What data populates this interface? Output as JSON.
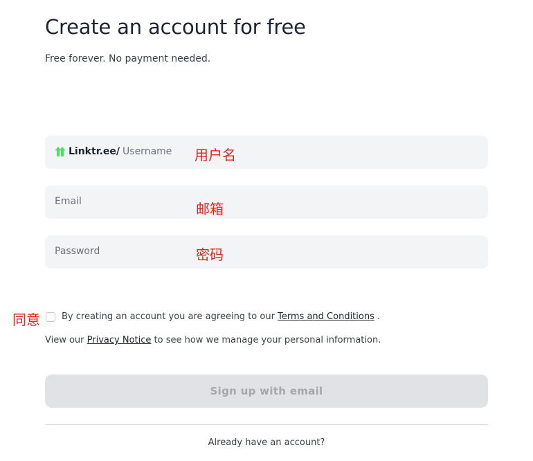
{
  "header": {
    "title": "Create an account for free",
    "subtitle": "Free forever. No payment needed."
  },
  "form": {
    "username": {
      "prefix_brand": "Linktr.ee/",
      "placeholder": "Username",
      "logo_icon": "linktree-logo-icon",
      "annotation": "用户名"
    },
    "email": {
      "placeholder": "Email",
      "annotation": "邮箱"
    },
    "password": {
      "placeholder": "Password",
      "annotation": "密码"
    },
    "terms": {
      "checked": false,
      "annotation": "同意",
      "text_before": "By creating an account you are agreeing to our ",
      "link_label": "Terms and Conditions",
      "text_after": " ."
    },
    "privacy": {
      "text_before": "View our ",
      "link_label": "Privacy Notice",
      "text_after": " to see how we manage your personal information."
    },
    "signup_label": "Sign up with email"
  },
  "footer": {
    "login_prompt": "Already have an account?"
  },
  "colors": {
    "annotation": "#e3231b",
    "logo_green": "#43e660",
    "field_background": "#f3f4f6",
    "button_disabled_background": "#e0e2e5",
    "button_disabled_text": "#a4a8ae"
  }
}
